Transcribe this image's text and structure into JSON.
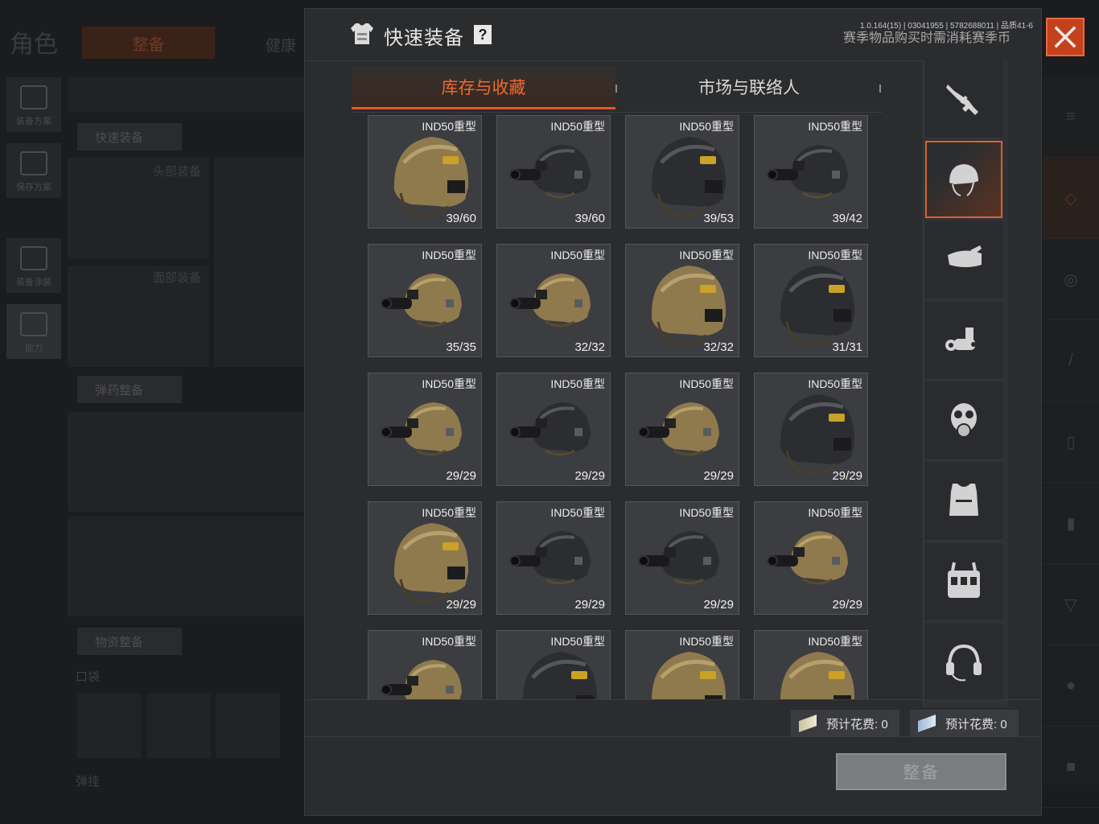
{
  "background": {
    "page_title": "角色",
    "tab_active": "整备",
    "tab_other": "健康",
    "side_buttons": [
      "装备方案",
      "保存方案",
      "装备涂装",
      "能力"
    ],
    "currency_count": "0",
    "help": "?",
    "quick_equip_label": "快速装备",
    "head_slot": "头部装备",
    "face_slot": "面部装备",
    "ammo_label": "弹药整备",
    "supply_label": "物资整备",
    "pocket_label": "口袋",
    "sling_label": "弹挂"
  },
  "modal": {
    "title": "快速装备",
    "help": "?",
    "notice": "赛季物品购买时需消耗赛季币",
    "version": "1.0.164(15) | 03041955 | 5782688011 | 品质41-6",
    "tabs": [
      {
        "label": "库存与收藏",
        "active": true
      },
      {
        "label": "市场与联络人",
        "active": false
      }
    ],
    "items": [
      {
        "name": "IND50重型",
        "count": "39/60",
        "color": "tan",
        "nvg": false
      },
      {
        "name": "IND50重型",
        "count": "39/60",
        "color": "black",
        "nvg": true
      },
      {
        "name": "IND50重型",
        "count": "39/53",
        "color": "black",
        "nvg": false
      },
      {
        "name": "IND50重型",
        "count": "39/42",
        "color": "black",
        "nvg": true
      },
      {
        "name": "IND50重型",
        "count": "35/35",
        "color": "tan",
        "nvg": true
      },
      {
        "name": "IND50重型",
        "count": "32/32",
        "color": "tan",
        "nvg": true
      },
      {
        "name": "IND50重型",
        "count": "32/32",
        "color": "tan",
        "nvg": false
      },
      {
        "name": "IND50重型",
        "count": "31/31",
        "color": "black",
        "nvg": false
      },
      {
        "name": "IND50重型",
        "count": "29/29",
        "color": "tan",
        "nvg": true
      },
      {
        "name": "IND50重型",
        "count": "29/29",
        "color": "black",
        "nvg": true
      },
      {
        "name": "IND50重型",
        "count": "29/29",
        "color": "tan",
        "nvg": true
      },
      {
        "name": "IND50重型",
        "count": "29/29",
        "color": "black",
        "nvg": false
      },
      {
        "name": "IND50重型",
        "count": "29/29",
        "color": "tan",
        "nvg": false
      },
      {
        "name": "IND50重型",
        "count": "29/29",
        "color": "black",
        "nvg": true
      },
      {
        "name": "IND50重型",
        "count": "29/29",
        "color": "black",
        "nvg": true
      },
      {
        "name": "IND50重型",
        "count": "29/29",
        "color": "tan",
        "nvg": true
      },
      {
        "name": "IND50重型",
        "count": "",
        "color": "tan",
        "nvg": true
      },
      {
        "name": "IND50重型",
        "count": "",
        "color": "black",
        "nvg": false
      },
      {
        "name": "IND50重型",
        "count": "",
        "color": "tan",
        "nvg": false
      },
      {
        "name": "IND50重型",
        "count": "",
        "color": "tan",
        "nvg": false
      }
    ],
    "categories": [
      {
        "icon": "rifle-icon",
        "active": false
      },
      {
        "icon": "helmet-icon",
        "active": true
      },
      {
        "icon": "cap-icon",
        "active": false
      },
      {
        "icon": "nvg-icon",
        "active": false
      },
      {
        "icon": "gas-mask-icon",
        "active": false
      },
      {
        "icon": "armor-vest-icon",
        "active": false
      },
      {
        "icon": "chest-rig-icon",
        "active": false
      },
      {
        "icon": "headset-icon",
        "active": false
      }
    ],
    "costs": [
      {
        "label": "预计花费: 0"
      },
      {
        "label": "预计花费: 0"
      }
    ],
    "equip_button": "整备",
    "colors": {
      "accent": "#e05a22",
      "close": "#c4411d",
      "tan": "#8f7a4e",
      "black": "#2a2b2f"
    }
  }
}
